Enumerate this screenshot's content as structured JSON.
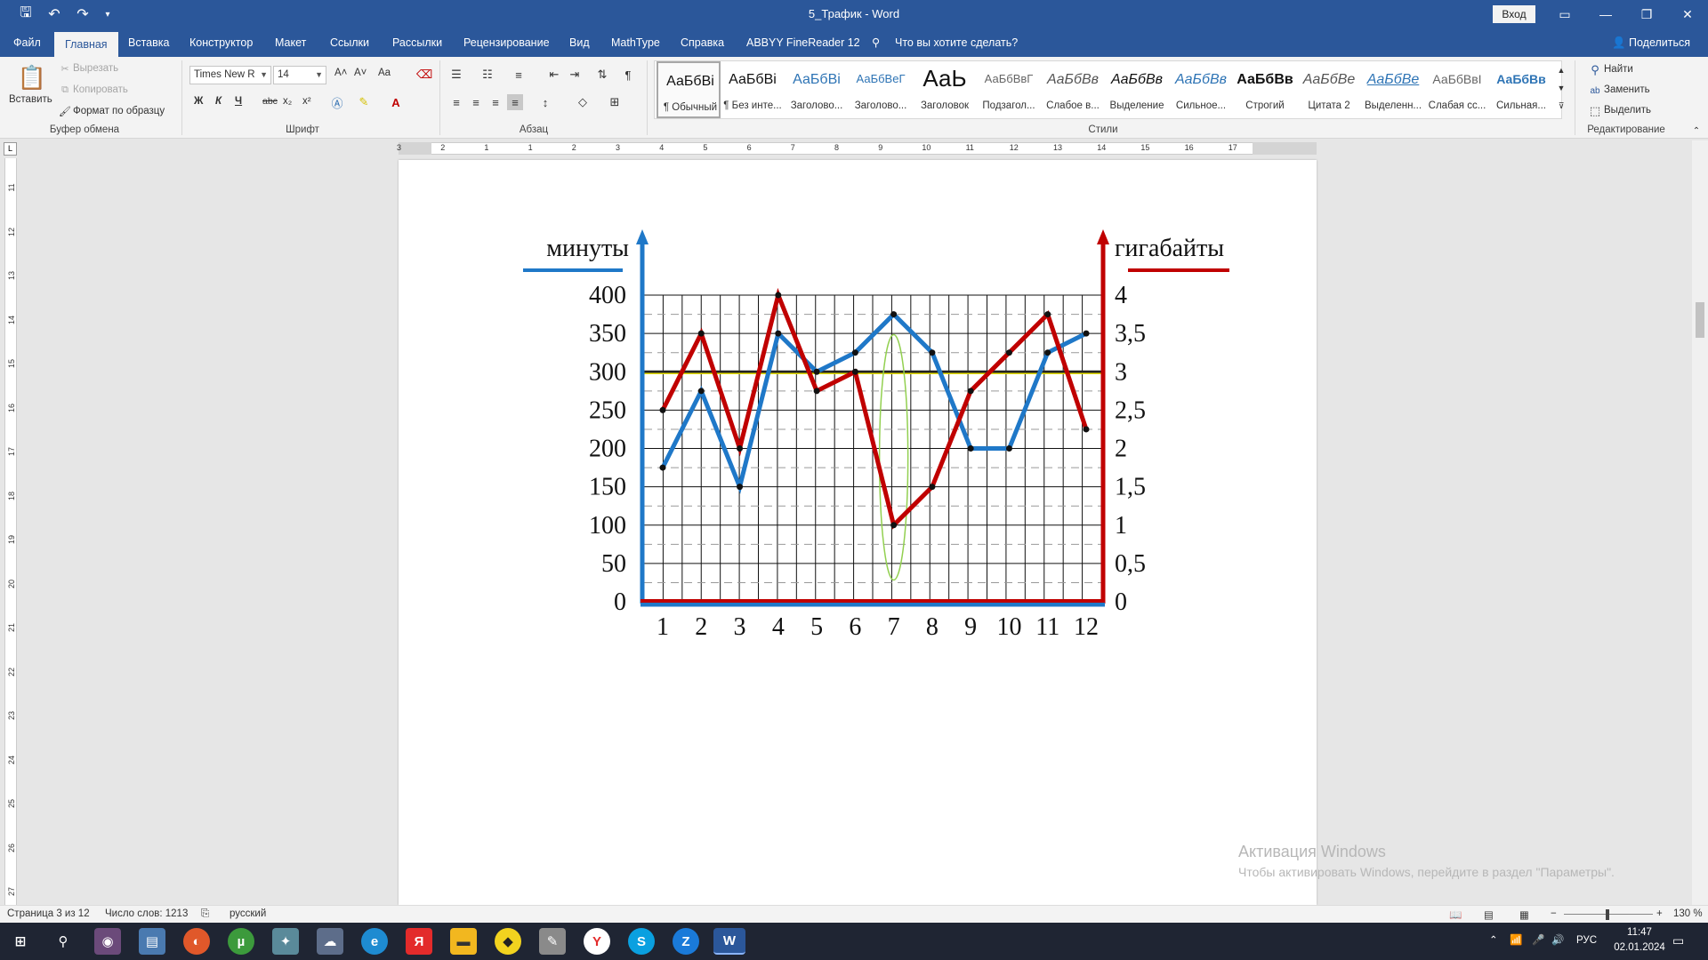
{
  "window": {
    "title": "5_Трафик  -  Word",
    "signin_label": "Вход",
    "minimize_glyph": "—",
    "restore_glyph": "❐",
    "close_glyph": "✕"
  },
  "tabs": [
    {
      "label": "Файл"
    },
    {
      "label": "Главная"
    },
    {
      "label": "Вставка"
    },
    {
      "label": "Конструктор"
    },
    {
      "label": "Макет"
    },
    {
      "label": "Ссылки"
    },
    {
      "label": "Рассылки"
    },
    {
      "label": "Рецензирование"
    },
    {
      "label": "Вид"
    },
    {
      "label": "MathType"
    },
    {
      "label": "Справка"
    },
    {
      "label": "ABBYY FineReader 12"
    },
    {
      "label": "Что вы хотите сделать?"
    }
  ],
  "share_label": "Поделиться",
  "ribbon": {
    "clipboard": {
      "paste": "Вставить",
      "cut": "Вырезать",
      "copy": "Копировать",
      "format_painter": "Формат по образцу",
      "group": "Буфер обмена"
    },
    "font": {
      "name": "Times New R",
      "size": "14",
      "group": "Шрифт",
      "bold": "Ж",
      "italic": "К",
      "underline": "Ч",
      "strike": "abc",
      "subscript": "x₂",
      "superscript": "x²",
      "grow": "A˄",
      "shrink": "A˅",
      "change_case": "Aa"
    },
    "paragraph": {
      "group": "Абзац"
    },
    "styles": {
      "group": "Стили",
      "items": [
        {
          "sample": "АаБбВі",
          "name": "¶ Обычный"
        },
        {
          "sample": "АаБбВі",
          "name": "¶ Без инте..."
        },
        {
          "sample": "АаБбВі",
          "name": "Заголово..."
        },
        {
          "sample": "АаБбВеГ",
          "name": "Заголово..."
        },
        {
          "sample": "АаЬ",
          "name": "Заголовок"
        },
        {
          "sample": "АаБбВвГ",
          "name": "Подзагол..."
        },
        {
          "sample": "АаБбВв",
          "name": "Слабое в..."
        },
        {
          "sample": "АаБбВв",
          "name": "Выделение"
        },
        {
          "sample": "АаБбВв",
          "name": "Сильное..."
        },
        {
          "sample": "АаБбВв",
          "name": "Строгий"
        },
        {
          "sample": "АаБбВе",
          "name": "Цитата 2"
        },
        {
          "sample": "АаБбВе",
          "name": "Выделенн..."
        },
        {
          "sample": "АаБбВвІ",
          "name": "Слабая сс..."
        },
        {
          "sample": "АаБбВв",
          "name": "Сильная..."
        }
      ]
    },
    "editing": {
      "group": "Редактирование",
      "find": "Найти",
      "replace": "Заменить",
      "select": "Выделить"
    }
  },
  "ruler": {
    "h_marks": [
      "3",
      "2",
      "1",
      "1",
      "2",
      "3",
      "4",
      "5",
      "6",
      "7",
      "8",
      "9",
      "10",
      "11",
      "12",
      "13",
      "14",
      "15",
      "16",
      "17"
    ],
    "v_marks": [
      "11",
      "12",
      "13",
      "14",
      "15",
      "16",
      "17",
      "18",
      "19",
      "20",
      "21",
      "22",
      "23",
      "24",
      "25",
      "26",
      "27"
    ]
  },
  "chart_data": {
    "type": "line",
    "categories": [
      "1",
      "2",
      "3",
      "4",
      "5",
      "6",
      "7",
      "8",
      "9",
      "10",
      "11",
      "12"
    ],
    "series": [
      {
        "name": "минуты",
        "axis": "left",
        "color": "#1f78c8",
        "values": [
          175,
          275,
          150,
          350,
          300,
          325,
          375,
          325,
          200,
          200,
          325,
          350
        ]
      },
      {
        "name": "гигабайты",
        "axis": "right",
        "color": "#c00000",
        "values": [
          2.5,
          3.5,
          2,
          4,
          2.75,
          3,
          1,
          1.5,
          2.75,
          3.25,
          3.75,
          2.25
        ]
      }
    ],
    "left_axis": {
      "label": "минуты",
      "ticks": [
        "0",
        "50",
        "100",
        "150",
        "200",
        "250",
        "300",
        "350",
        "400"
      ],
      "range": [
        0,
        400
      ]
    },
    "right_axis": {
      "label": "гигабайты",
      "ticks": [
        "0",
        "0,5",
        "1",
        "1,5",
        "2",
        "2,5",
        "3",
        "3,5",
        "4"
      ],
      "range": [
        0,
        4
      ]
    },
    "reference_line": 300,
    "highlight_category": "7",
    "grid": true
  },
  "watermark": {
    "line1": "Активация Windows",
    "line2": "Чтобы активировать Windows, перейдите в раздел \"Параметры\"."
  },
  "status": {
    "page": "Страница 3 из 12",
    "words": "Число слов: 1213",
    "language": "русский",
    "zoom": "130 %"
  },
  "taskbar": {
    "lang": "РУС",
    "time": "11:47",
    "date": "02.01.2024"
  },
  "colors": {
    "title_bar": "#2b579a",
    "minutes_series": "#1f78c8",
    "gigabytes_series": "#c00000"
  }
}
